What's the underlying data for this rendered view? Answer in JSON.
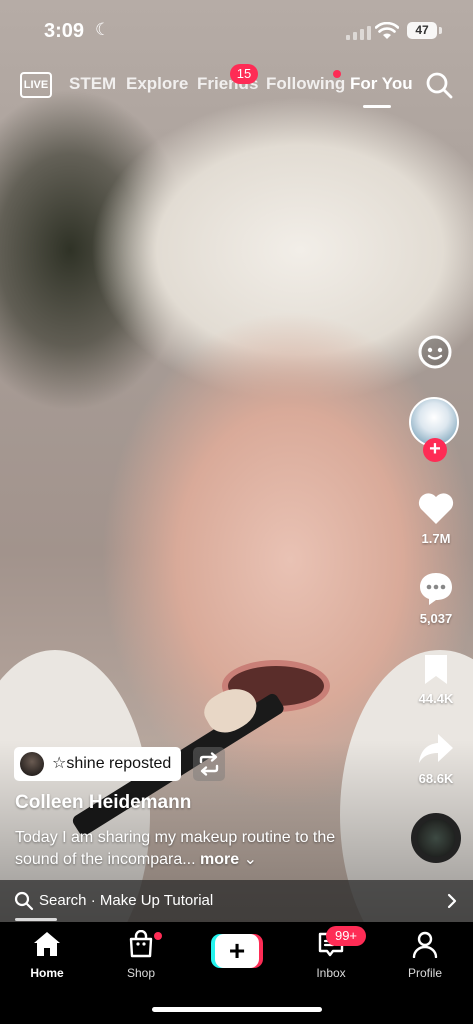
{
  "status_bar": {
    "time": "3:09",
    "focus_icon": "moon-icon",
    "battery": "47",
    "icons": [
      "cellular-signal-icon",
      "wifi-icon",
      "battery-icon"
    ]
  },
  "top_nav": {
    "live_label": "LIVE",
    "tabs": [
      {
        "label": "STEM",
        "active": false
      },
      {
        "label": "Explore",
        "active": false
      },
      {
        "label": "Friends",
        "active": false,
        "badge": "15"
      },
      {
        "label": "Following",
        "active": false,
        "dot": true
      },
      {
        "label": "For You",
        "active": true
      }
    ],
    "search_icon": "search-icon"
  },
  "right_rail": {
    "likes": "1.7M",
    "comments": "5,037",
    "saves": "44.4K",
    "shares": "68.6K",
    "follow_symbol": "+",
    "icons": [
      "emoji-icon",
      "heart-icon",
      "comment-icon",
      "bookmark-icon",
      "share-icon",
      "sound-disc-icon"
    ]
  },
  "video_info": {
    "repost_label": "☆shine reposted",
    "author": "Colleen Heidemann",
    "caption": "Today I am sharing my makeup routine to the sound of the incompara...",
    "more_label": "more"
  },
  "search_suggestion": {
    "text": "Search · Make Up Tutorial"
  },
  "bottom_nav": {
    "items": [
      {
        "label": "Home",
        "icon": "home-icon",
        "active": true
      },
      {
        "label": "Shop",
        "icon": "shop-bag-icon",
        "dot": true
      },
      {
        "label": "",
        "icon": "create-plus-icon",
        "symbol": "+"
      },
      {
        "label": "Inbox",
        "icon": "inbox-icon",
        "badge": "99+"
      },
      {
        "label": "Profile",
        "icon": "profile-icon"
      }
    ]
  },
  "colors": {
    "accent_red": "#fe2c55",
    "accent_cyan": "#25f4ee",
    "text": "#ffffff"
  }
}
